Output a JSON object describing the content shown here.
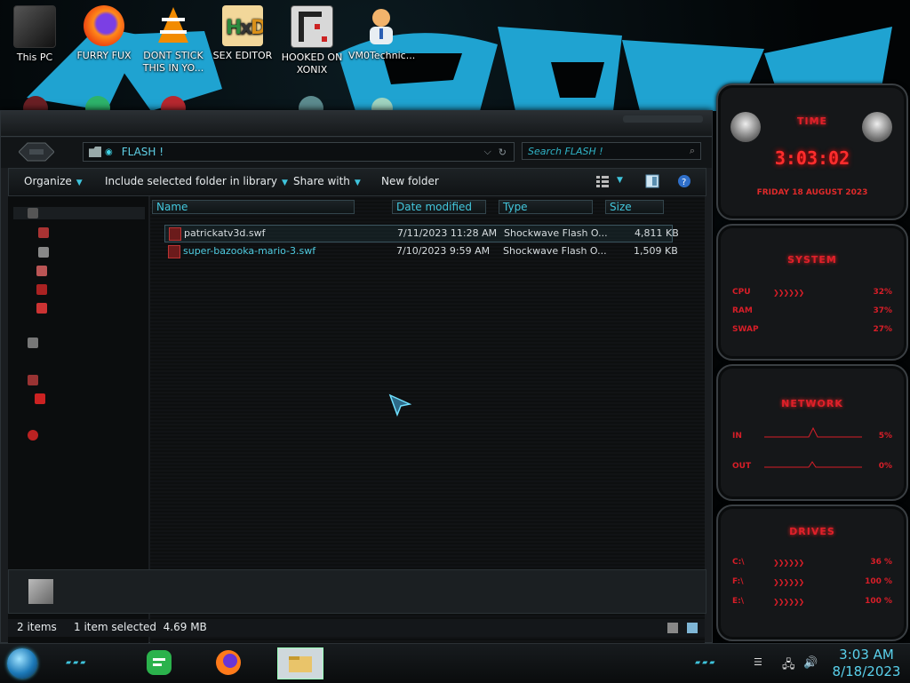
{
  "desktop": {
    "icons": [
      {
        "label": "This PC",
        "icon": "this-pc-icon"
      },
      {
        "label": "FURRY FUX",
        "icon": "firefox-icon"
      },
      {
        "label": "DONT STICK THIS IN YO...",
        "icon": "vlc-icon"
      },
      {
        "label": "SEX EDITOR",
        "icon": "hxd-icon"
      },
      {
        "label": "HOOKED ON XONIX",
        "icon": "game-icon"
      },
      {
        "label": "VM0Technic...",
        "icon": "person-icon"
      }
    ]
  },
  "explorer": {
    "address": {
      "path": "FLASH !"
    },
    "search": {
      "placeholder": "Search FLASH !"
    },
    "toolbar": {
      "organize": "Organize",
      "include_library": "Include selected folder in library",
      "share_with": "Share with",
      "new_folder": "New folder"
    },
    "columns": {
      "name": "Name",
      "date_modified": "Date modified",
      "type": "Type",
      "size": "Size"
    },
    "files": [
      {
        "name": "patrickatv3d.swf",
        "date": "7/11/2023 11:28 AM",
        "type": "Shockwave Flash O...",
        "size": "4,811 KB",
        "selected": true
      },
      {
        "name": "super-bazooka-mario-3.swf",
        "date": "7/10/2023 9:59 AM",
        "type": "Shockwave Flash O...",
        "size": "1,509 KB",
        "selected": false
      }
    ],
    "status": {
      "items": "2 items",
      "selection": "1 item selected  4.69 MB"
    }
  },
  "gadgets": {
    "time": {
      "title": "TIME",
      "clock": "3:03:02",
      "date": "FRIDAY 18 AUGUST 2023"
    },
    "system": {
      "title": "SYSTEM",
      "rows": [
        {
          "label": "CPU",
          "value": "32%"
        },
        {
          "label": "RAM",
          "value": "37%"
        },
        {
          "label": "SWAP",
          "value": "27%"
        }
      ]
    },
    "network": {
      "title": "NETWORK",
      "rows": [
        {
          "label": "IN",
          "value": "5%"
        },
        {
          "label": "OUT",
          "value": "0%"
        }
      ]
    },
    "drives": {
      "title": "DRIVES",
      "rows": [
        {
          "label": "C:\\",
          "value": "36 %"
        },
        {
          "label": "F:\\",
          "value": "100 %"
        },
        {
          "label": "E:\\",
          "value": "100 %"
        }
      ]
    }
  },
  "taskbar": {
    "time": "3:03 AM",
    "date": "8/18/2023",
    "apps": [
      "feedly-icon",
      "firefox-icon",
      "file-explorer-icon"
    ]
  },
  "colors": {
    "accent": "#3fc4dc",
    "gadget_red": "#e0202a",
    "wallpaper_blue": "#1fa3d1"
  }
}
